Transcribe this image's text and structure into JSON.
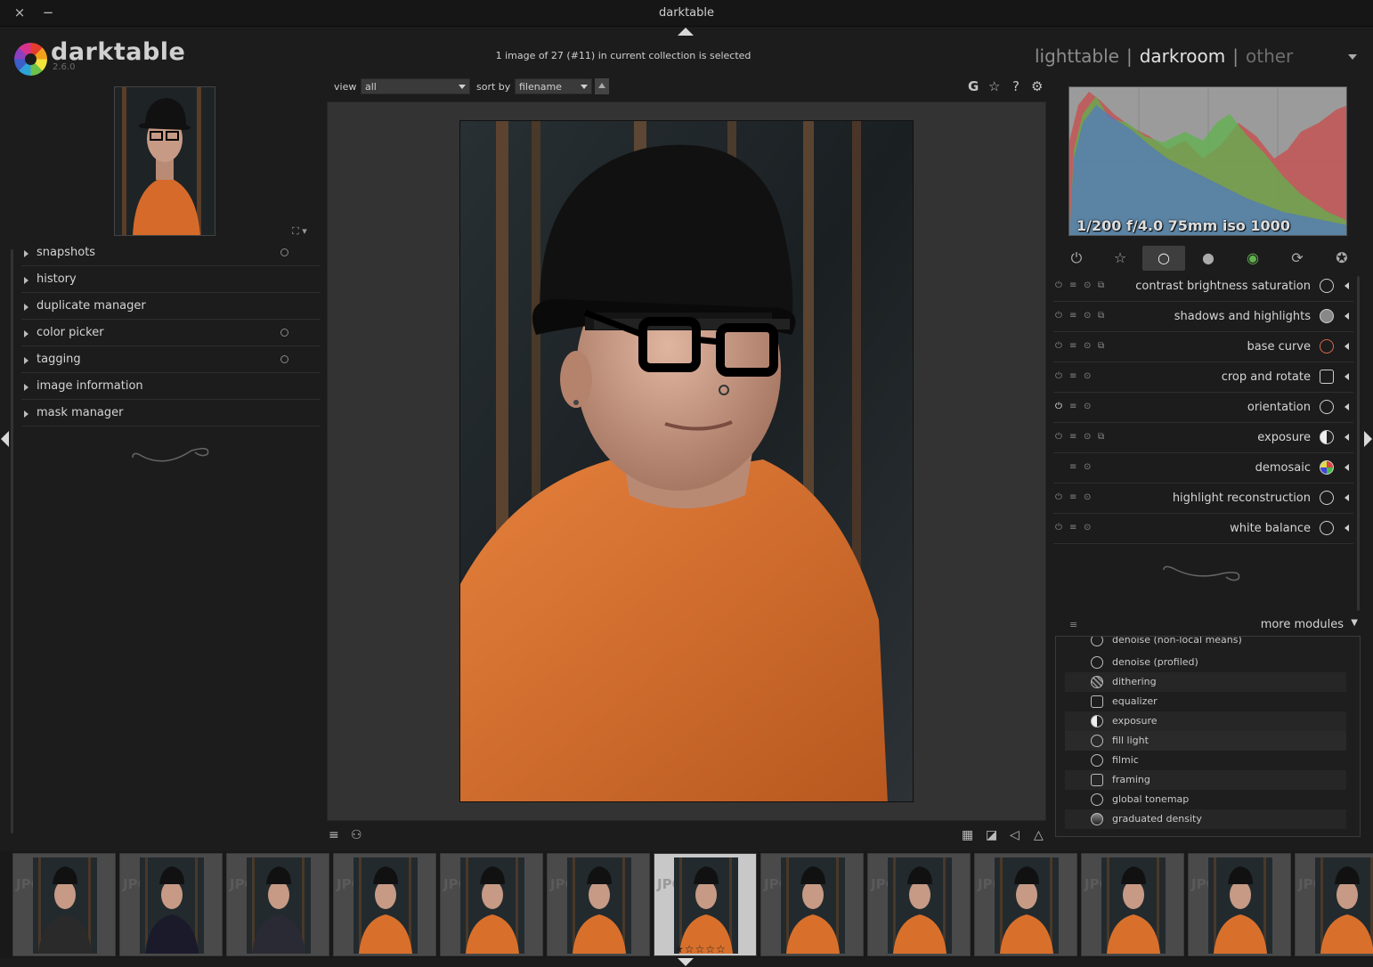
{
  "window": {
    "title": "darktable",
    "close_icon": "×",
    "minimize_icon": "−"
  },
  "app": {
    "name": "darktable",
    "version": "2.6.0"
  },
  "collection_info": "1 image of 27 (#11) in current collection is selected",
  "views": {
    "lighttable": "lighttable",
    "darkroom": "darkroom",
    "other": "other",
    "separator": "|"
  },
  "top_toolbar": {
    "view_label": "view",
    "view_value": "all",
    "sort_label": "sort by",
    "sort_value": "filename",
    "icons": {
      "grouping": "G",
      "overlays": "☆",
      "help": "?",
      "prefs": "⚙"
    }
  },
  "left_modules": [
    {
      "label": "snapshots",
      "reset": true
    },
    {
      "label": "history",
      "reset": false
    },
    {
      "label": "duplicate manager",
      "reset": false
    },
    {
      "label": "color picker",
      "reset": true
    },
    {
      "label": "tagging",
      "reset": true
    },
    {
      "label": "image information",
      "reset": false
    },
    {
      "label": "mask manager",
      "reset": false
    }
  ],
  "histogram": {
    "exif": "1/200 f/4.0 75mm iso 1000"
  },
  "module_groups": [
    "⏻",
    "☆",
    "○",
    "●",
    "◉",
    "⟳",
    "✪"
  ],
  "right_modules": [
    {
      "label": "contrast brightness saturation",
      "icon": "cbs-icon",
      "on": false
    },
    {
      "label": "shadows and highlights",
      "icon": "shadows-icon",
      "on": false
    },
    {
      "label": "base curve",
      "icon": "curve-icon",
      "on": false
    },
    {
      "label": "crop and rotate",
      "icon": "crop-icon",
      "on": false
    },
    {
      "label": "orientation",
      "icon": "orientation-icon",
      "on": true
    },
    {
      "label": "exposure",
      "icon": "exposure-icon",
      "on": false
    },
    {
      "label": "demosaic",
      "icon": "demosaic-icon",
      "on": false
    },
    {
      "label": "highlight reconstruction",
      "icon": "highlight-icon",
      "on": false
    },
    {
      "label": "white balance",
      "icon": "wb-icon",
      "on": false
    }
  ],
  "more_modules": {
    "label": "more modules",
    "partial_top": "denoise (non-local means)",
    "items": [
      "denoise (profiled)",
      "dithering",
      "equalizer",
      "exposure",
      "fill light",
      "filmic",
      "framing",
      "global tonemap",
      "graduated density"
    ]
  },
  "filmstrip": {
    "selected_index": 6,
    "count": 13,
    "jpg_label": "JPG",
    "stars": "★☆☆☆☆"
  }
}
